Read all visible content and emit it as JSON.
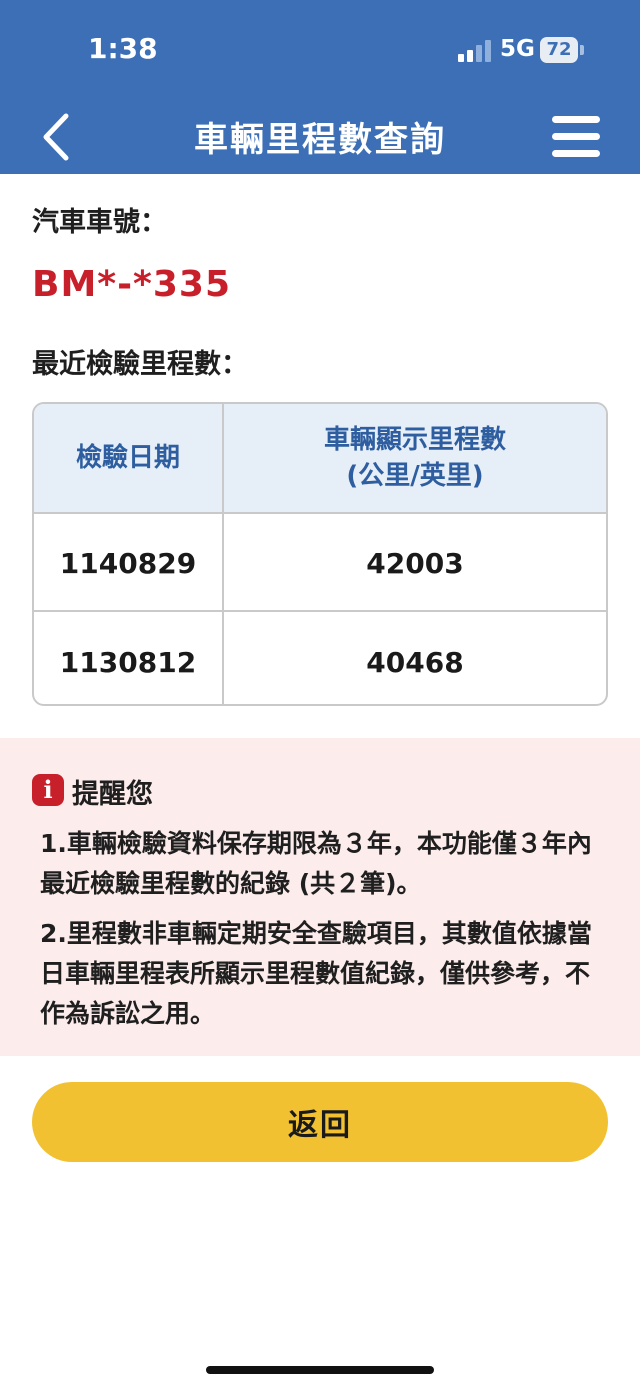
{
  "status_bar": {
    "time": "1:38",
    "network": "5G",
    "battery": "72"
  },
  "header": {
    "title": "車輛里程數查詢",
    "back_icon": "chevron-left-icon",
    "menu_icon": "hamburger-menu-icon",
    "background_color": "#3c6fb5"
  },
  "vehicle": {
    "plate_label": "汽車車號：",
    "plate_number": "BM*-*335",
    "plate_color": "#c8202b"
  },
  "records": {
    "section_label": "最近檢驗里程數：",
    "columns": [
      "檢驗日期",
      "車輛顯示里程數",
      "(公里/英里)"
    ],
    "rows": [
      {
        "date": "1140829",
        "mileage": "42003"
      },
      {
        "date": "1130812",
        "mileage": "40468"
      }
    ]
  },
  "notice": {
    "icon": "info-icon",
    "title": "提醒您",
    "items": [
      "1.車輛檢驗資料保存期限為３年，本功能僅３年內最近檢驗里程數的紀錄 (共２筆)。",
      "2.里程數非車輛定期安全查驗項目，其數值依據當日車輛里程表所顯示里程數值紀錄，僅供參考，不作為訴訟之用。"
    ],
    "background_color": "#fcecec"
  },
  "actions": {
    "return_label": "返回",
    "return_color": "#f1c132"
  }
}
